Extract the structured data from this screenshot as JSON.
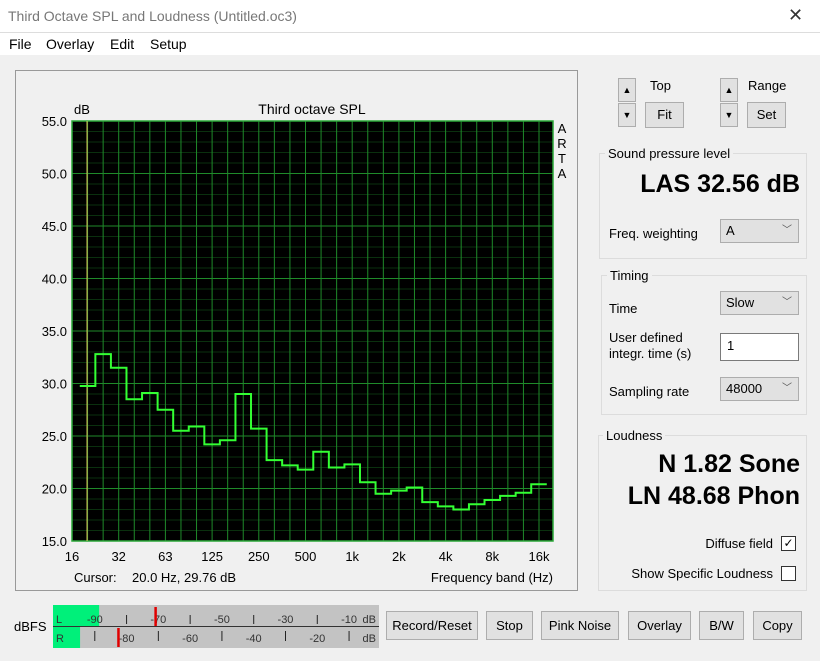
{
  "window": {
    "title": "Third Octave SPL and Loudness (Untitled.oc3)",
    "close_icon": "close-icon"
  },
  "menu": [
    "File",
    "Overlay",
    "Edit",
    "Setup"
  ],
  "controls": {
    "top_label": "Top",
    "fit_label": "Fit",
    "range_label": "Range",
    "set_label": "Set"
  },
  "spl": {
    "group": "Sound pressure level",
    "value": "LAS 32.56 dB",
    "weighting_label": "Freq. weighting",
    "weighting": "A"
  },
  "timing": {
    "group": "Timing",
    "time_label": "Time",
    "time": "Slow",
    "integr_label_1": "User defined",
    "integr_label_2": "integr. time (s)",
    "integr_value": "1",
    "rate_label": "Sampling rate",
    "rate": "48000"
  },
  "loudness": {
    "group": "Loudness",
    "sone": "N 1.82 Sone",
    "phon": "LN 48.68 Phon",
    "diffuse_label": "Diffuse field",
    "diffuse_checked": true,
    "specific_label": "Show Specific Loudness",
    "specific_checked": false
  },
  "meter": {
    "label": "dBFS",
    "L": "L",
    "R": "R",
    "l_ticks": [
      "-90",
      "-70",
      "-50",
      "-30",
      "-10"
    ],
    "r_ticks": [
      "-80",
      "-60",
      "-40",
      "-20"
    ],
    "unit": "dB",
    "l_level_db": -88,
    "l_peak_db": -70,
    "r_level_db": -94,
    "r_peak_db": -82,
    "fill_color": "#00f07a",
    "peak_color": "#e00000"
  },
  "buttons": [
    "Record/Reset",
    "Stop",
    "Pink Noise",
    "Overlay",
    "B/W",
    "Copy"
  ],
  "chart_data": {
    "type": "line",
    "title": "Third octave SPL",
    "ylabel": "dB",
    "xlabel": "Frequency band (Hz)",
    "side_label": "ARTA",
    "ylim": [
      15,
      55
    ],
    "xlim_hz": [
      16,
      20000
    ],
    "x_scale": "log",
    "grid": true,
    "y_ticks": [
      "55.0",
      "50.0",
      "45.0",
      "40.0",
      "35.0",
      "30.0",
      "25.0",
      "20.0",
      "15.0"
    ],
    "x_ticks": [
      "16",
      "32",
      "63",
      "125",
      "250",
      "500",
      "1k",
      "2k",
      "4k",
      "8k",
      "16k"
    ],
    "cursor_label": "Cursor:",
    "cursor_value": "20.0 Hz, 29.76 dB",
    "cursor_hz": 20,
    "bands_hz": [
      20,
      25,
      31.5,
      40,
      50,
      63,
      80,
      100,
      125,
      160,
      200,
      250,
      315,
      400,
      500,
      630,
      800,
      1000,
      1250,
      1600,
      2000,
      2500,
      3150,
      4000,
      5000,
      6300,
      8000,
      10000,
      12500,
      16000
    ],
    "values_db": [
      29.76,
      32.8,
      31.5,
      28.5,
      29.1,
      27.5,
      25.5,
      25.9,
      24.2,
      24.6,
      29.0,
      25.7,
      22.7,
      22.2,
      21.8,
      23.5,
      22.0,
      22.3,
      20.6,
      19.5,
      19.8,
      20.1,
      18.7,
      18.3,
      18.0,
      18.5,
      18.9,
      19.3,
      19.6,
      20.4
    ],
    "colors": {
      "background": "#000000",
      "grid": "#1f8a2a",
      "trace": "#33ff33",
      "cursor": "#e8d060"
    }
  }
}
